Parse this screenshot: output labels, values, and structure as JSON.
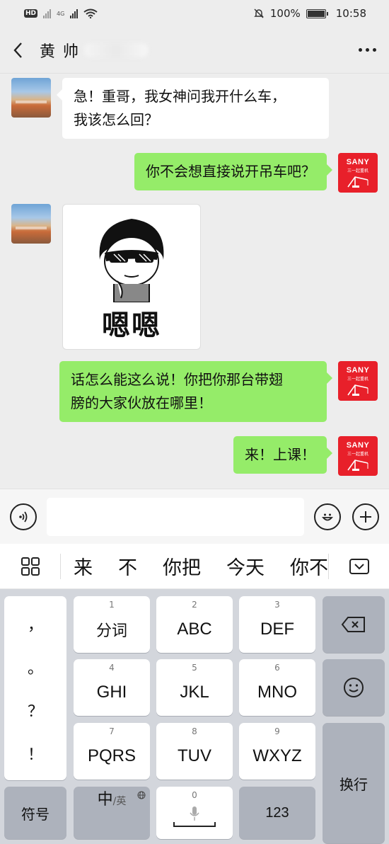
{
  "status": {
    "hd": "HD",
    "net": "4G",
    "battery_pct": "100%",
    "time": "10:58"
  },
  "header": {
    "title": "黄 帅"
  },
  "messages": [
    {
      "from": "other",
      "type": "text",
      "text_lines": [
        "急！重哥，我女神问我开什么车，",
        "我该怎么回？"
      ]
    },
    {
      "from": "me",
      "type": "text",
      "text_lines": [
        "你不会想直接说开吊车吧？"
      ]
    },
    {
      "from": "other",
      "type": "sticker",
      "text": "嗯嗯"
    },
    {
      "from": "me",
      "type": "text",
      "text_lines": [
        "话怎么能这么说！你把你那台带翅",
        "膀的大家伙放在哪里！"
      ]
    },
    {
      "from": "me",
      "type": "text",
      "text_lines": [
        "来！上课！"
      ]
    }
  ],
  "me_avatar": {
    "brand": "SANY",
    "sub": "三一起重机",
    "color": "#e8202a"
  },
  "input": {
    "placeholder": ""
  },
  "candidates": [
    "来",
    "不",
    "你把",
    "今天",
    "你不"
  ],
  "keyboard": {
    "punct": [
      "，",
      "。",
      "？",
      "！"
    ],
    "keys": [
      {
        "num": "1",
        "label": "分词"
      },
      {
        "num": "2",
        "label": "ABC"
      },
      {
        "num": "3",
        "label": "DEF"
      },
      {
        "num": "4",
        "label": "GHI"
      },
      {
        "num": "5",
        "label": "JKL"
      },
      {
        "num": "6",
        "label": "MNO"
      },
      {
        "num": "7",
        "label": "PQRS"
      },
      {
        "num": "8",
        "label": "TUV"
      },
      {
        "num": "9",
        "label": "WXYZ"
      }
    ],
    "symbol_label": "符号",
    "lang_main": "中",
    "lang_sub": "/英",
    "space_num": "0",
    "num_label": "123",
    "enter_label": "换行"
  },
  "colors": {
    "bubble_green": "#95ec69",
    "bubble_white": "#ffffff",
    "chat_bg": "#ededed",
    "keyboard_bg": "#d3d6dc"
  }
}
